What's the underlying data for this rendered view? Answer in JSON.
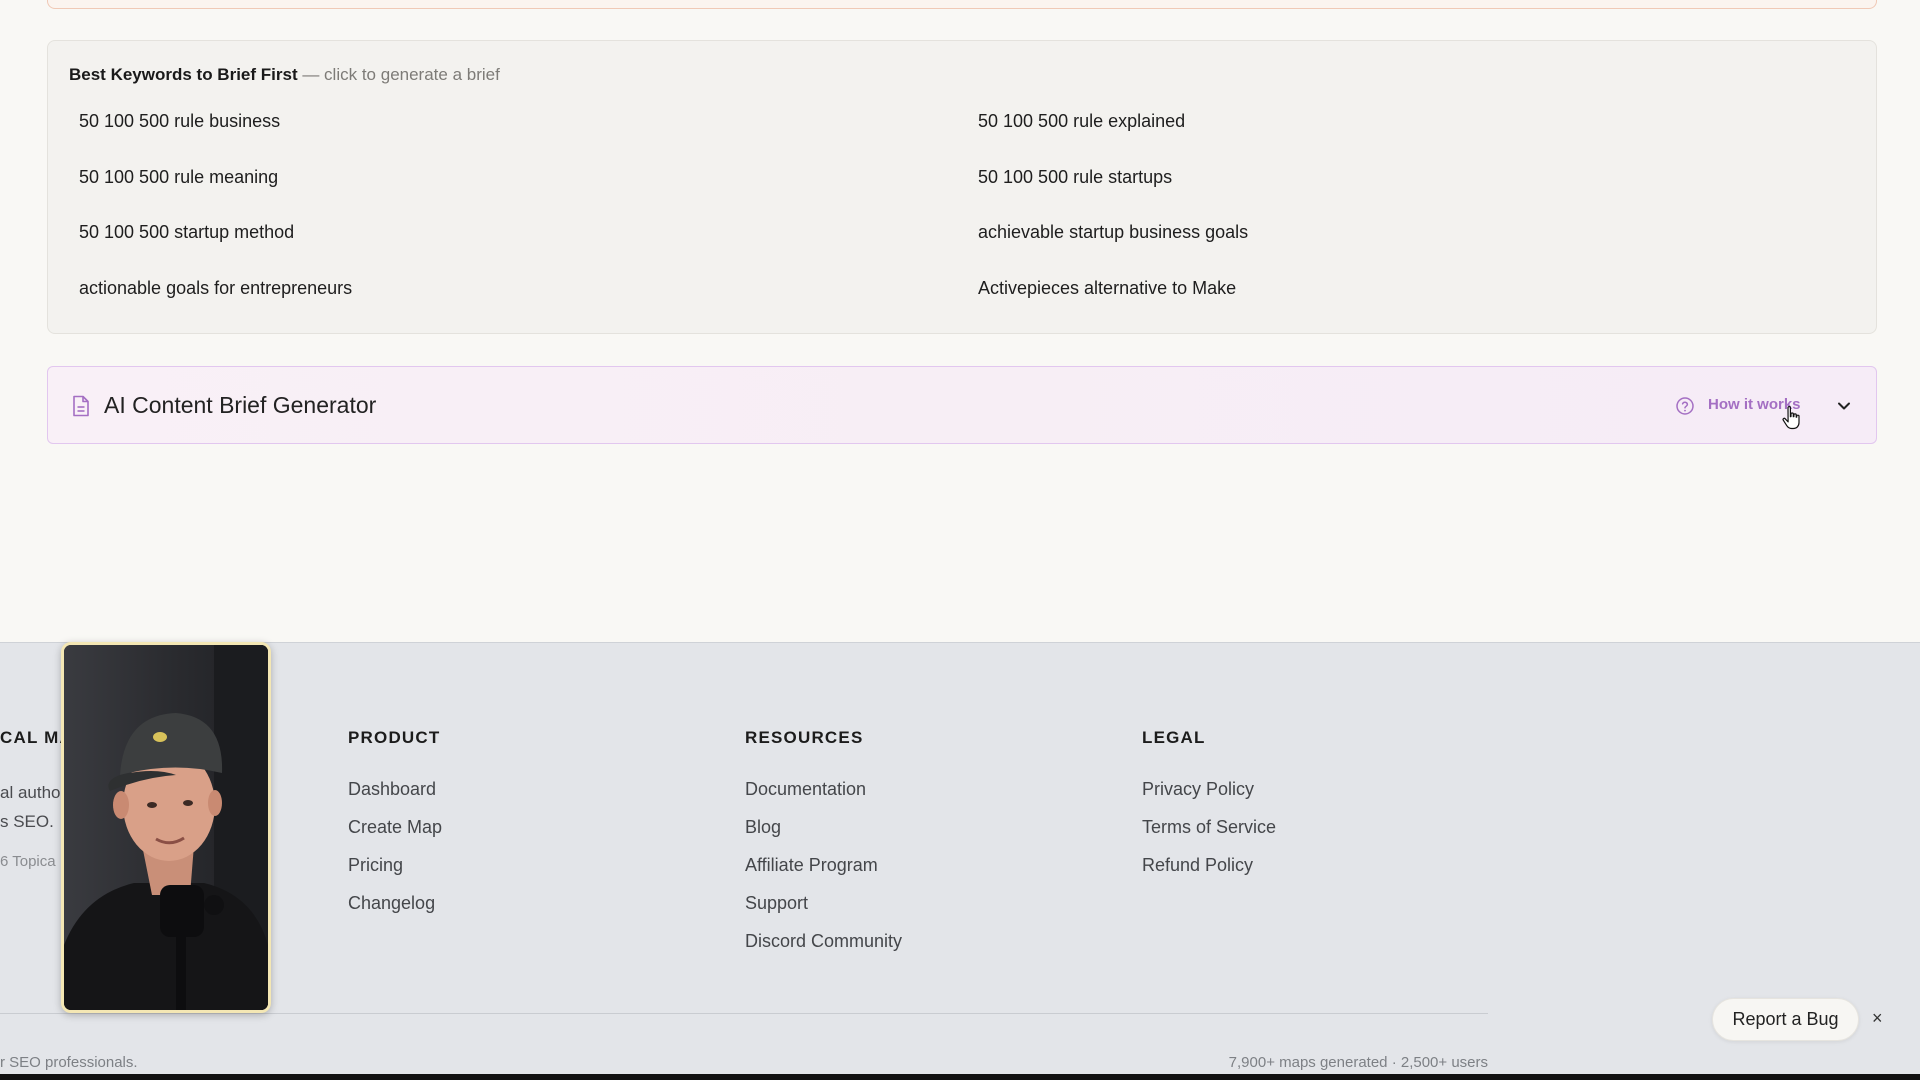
{
  "keywords": {
    "heading_strong": "Best Keywords to Brief First",
    "heading_hint": " — click to generate a brief",
    "items": [
      "50 100 500 rule business",
      "50 100 500 rule explained",
      "50 100 500 rule meaning",
      "50 100 500 rule startups",
      "50 100 500 startup method",
      "achievable startup business goals",
      "actionable goals for entrepreneurs",
      "Activepieces alternative to Make"
    ]
  },
  "brief": {
    "title": "AI Content Brief Generator",
    "how_label": "How it works",
    "icon": "document-icon",
    "accent": "#a46fc3"
  },
  "footer": {
    "brand_heading": "CAL MA",
    "brand_desc_line1": "al autho",
    "brand_desc_line2": "s SEO.",
    "brand_copy": "6 Topica",
    "columns": [
      {
        "heading": "PRODUCT",
        "links": [
          "Dashboard",
          "Create Map",
          "Pricing",
          "Changelog"
        ]
      },
      {
        "heading": "RESOURCES",
        "links": [
          "Documentation",
          "Blog",
          "Affiliate Program",
          "Support",
          "Discord Community"
        ]
      },
      {
        "heading": "LEGAL",
        "links": [
          "Privacy Policy",
          "Terms of Service",
          "Refund Policy"
        ]
      }
    ],
    "bottom_left": "r SEO professionals.",
    "bottom_right": "7,900+ maps generated · 2,500+ users"
  },
  "widgets": {
    "report_bug": "Report a Bug",
    "close": "×"
  }
}
